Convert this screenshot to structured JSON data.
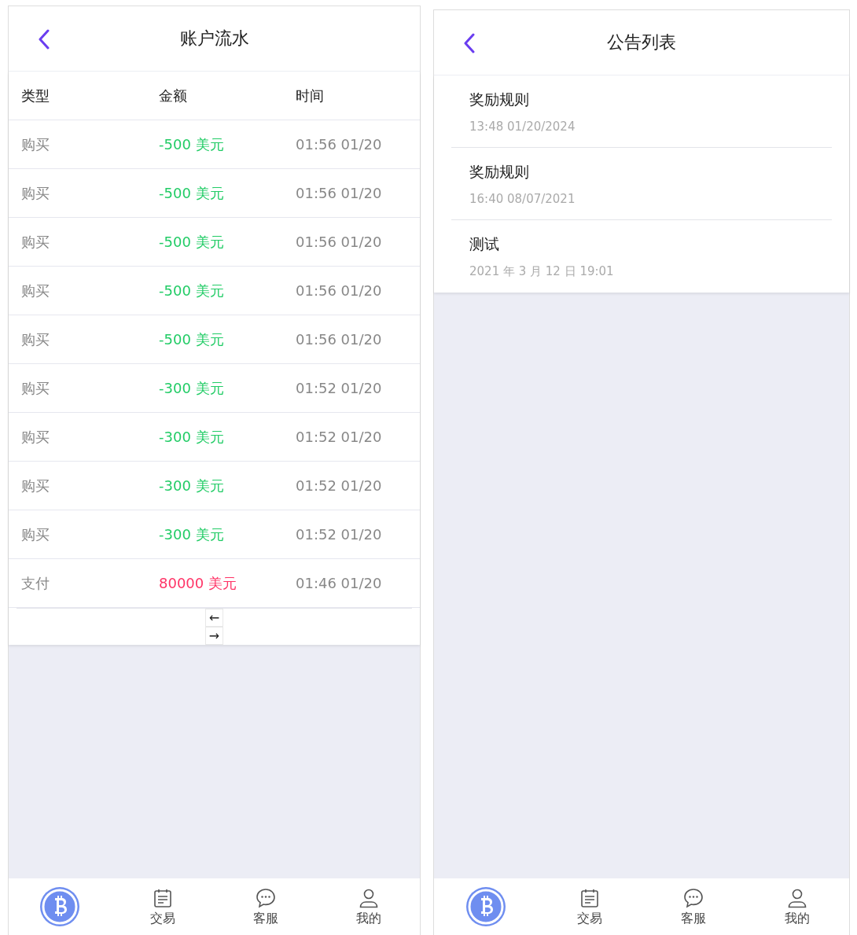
{
  "screens": [
    {
      "kind": "ledger",
      "title": "账户流水",
      "columns": [
        "类型",
        "金额",
        "时间"
      ],
      "rows": [
        {
          "type": "购买",
          "amount": "-500 美元",
          "color": "#22cc66",
          "time": "01:56 01/20"
        },
        {
          "type": "购买",
          "amount": "-500 美元",
          "color": "#22cc66",
          "time": "01:56 01/20"
        },
        {
          "type": "购买",
          "amount": "-500 美元",
          "color": "#22cc66",
          "time": "01:56 01/20"
        },
        {
          "type": "购买",
          "amount": "-500 美元",
          "color": "#22cc66",
          "time": "01:56 01/20"
        },
        {
          "type": "购买",
          "amount": "-500 美元",
          "color": "#22cc66",
          "time": "01:56 01/20"
        },
        {
          "type": "购买",
          "amount": "-300 美元",
          "color": "#22cc66",
          "time": "01:52 01/20"
        },
        {
          "type": "购买",
          "amount": "-300 美元",
          "color": "#22cc66",
          "time": "01:52 01/20"
        },
        {
          "type": "购买",
          "amount": "-300 美元",
          "color": "#22cc66",
          "time": "01:52 01/20"
        },
        {
          "type": "购买",
          "amount": "-300 美元",
          "color": "#22cc66",
          "time": "01:52 01/20"
        },
        {
          "type": "支付",
          "amount": "80000 美元",
          "color": "#ff3366",
          "time": "01:46 01/20"
        }
      ],
      "pager": [
        "←",
        "→"
      ],
      "nav": [
        {
          "kind": "logo"
        },
        {
          "kind": "trade",
          "label": "交易"
        },
        {
          "kind": "chat",
          "label": "客服"
        },
        {
          "kind": "user",
          "label": "我的"
        }
      ]
    },
    {
      "kind": "notices",
      "title": "公告列表",
      "items": [
        {
          "title": "奖励规则",
          "date": "13:48 01/20/2024"
        },
        {
          "title": "奖励规则",
          "date": "16:40 08/07/2021"
        },
        {
          "title": "测试",
          "date": "2021 年 3 月 12 日 19:01"
        }
      ],
      "nav": [
        {
          "kind": "logo"
        },
        {
          "kind": "trade",
          "label": "交易"
        },
        {
          "kind": "chat",
          "label": "客服"
        },
        {
          "kind": "user",
          "label": "我的"
        }
      ]
    }
  ]
}
